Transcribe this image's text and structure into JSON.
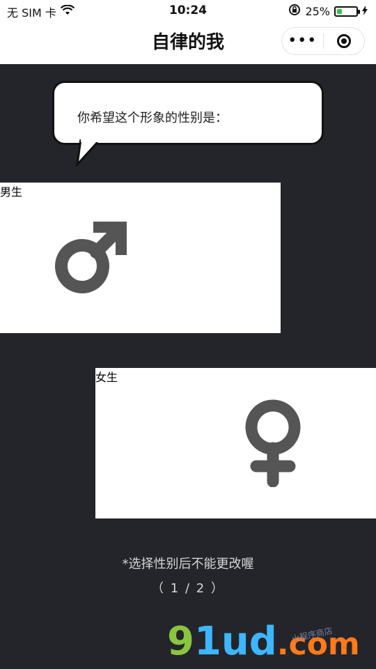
{
  "status_bar": {
    "carrier": "无 SIM 卡",
    "time": "10:24",
    "battery_percent": "25%",
    "battery_level": 0.25,
    "icons": [
      "wifi-icon",
      "lock-rotation-icon",
      "battery-icon",
      "charging-icon"
    ]
  },
  "nav": {
    "title": "自律的我",
    "more_label": "•••"
  },
  "question": {
    "text": "你希望这个形象的性别是："
  },
  "options": {
    "male": {
      "label": "男生",
      "icon": "male-symbol-icon",
      "color": "#555555"
    },
    "female": {
      "label": "女生",
      "icon": "female-symbol-icon",
      "color": "#555555"
    }
  },
  "footer": {
    "note": "*选择性别后不能更改喔",
    "pagination": "（ 1 / 2 ）"
  },
  "watermark": {
    "brand_g": "9",
    "brand_rest": "1ud",
    "domain": ".com",
    "sub": "小程序商店"
  },
  "colors": {
    "background": "#24252a",
    "card": "#ffffff",
    "text": "#222222",
    "note": "#d6d6d6"
  }
}
